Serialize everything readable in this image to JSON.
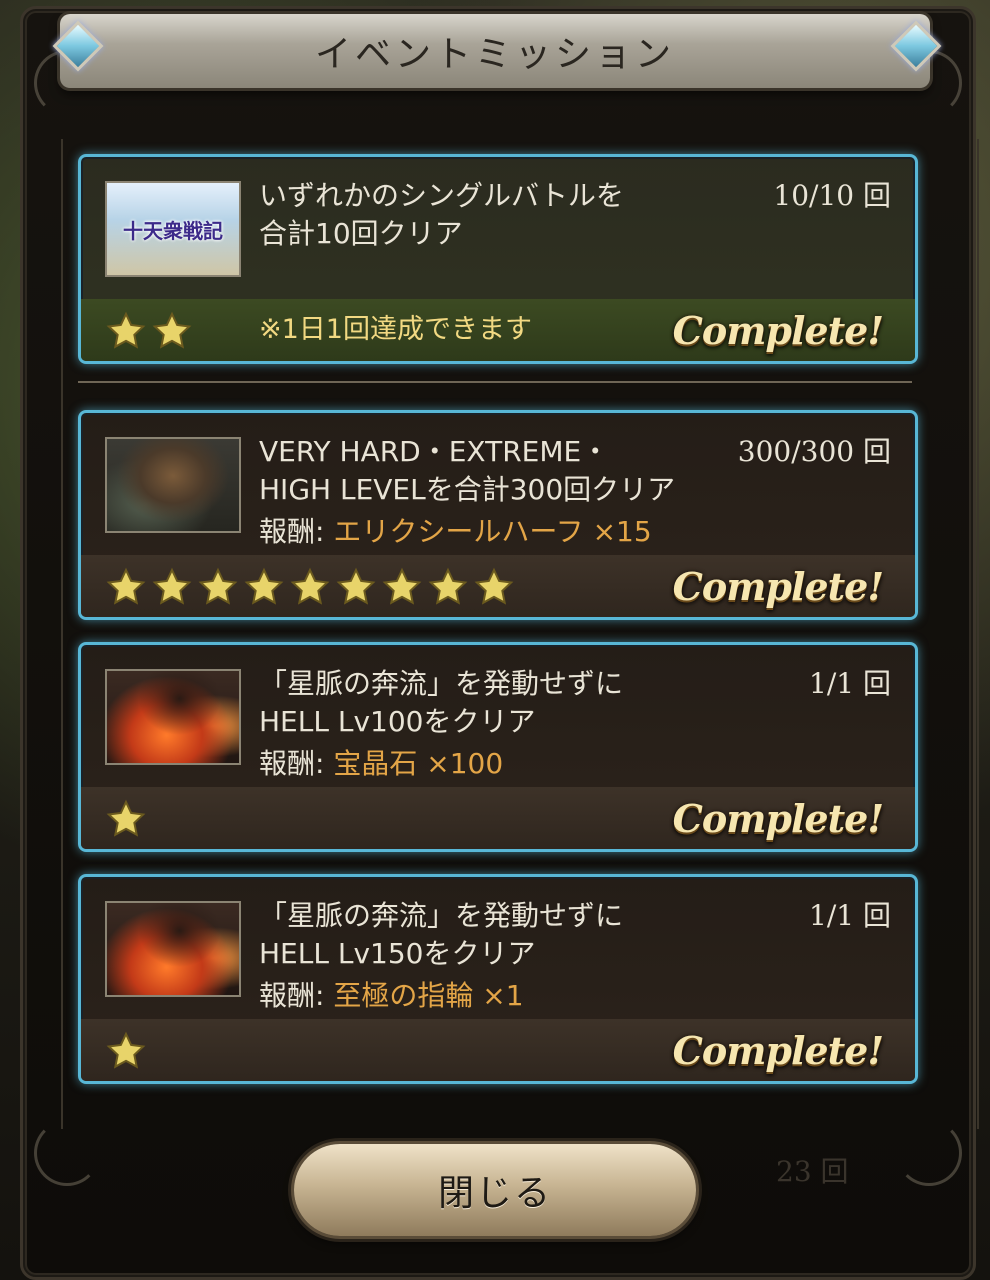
{
  "title": "イベントミッション",
  "missions": [
    {
      "description": "いずれかのシングルバトルを\n合計10回クリア",
      "count": "10/10 回",
      "thumbnail_text": "十天衆戦記",
      "note": "※1日1回達成できます",
      "stars": 2,
      "status": "Complete!"
    },
    {
      "description": "VERY HARD・EXTREME・\nHIGH LEVELを合計300回クリア",
      "count": "300/300 回",
      "reward_label": "報酬: ",
      "reward_item": "エリクシールハーフ ×15",
      "stars": 9,
      "status": "Complete!"
    },
    {
      "description": "「星脈の奔流」を発動せずに\nHELL Lv100をクリア",
      "count": "1/1 回",
      "reward_label": "報酬: ",
      "reward_item": "宝晶石 ×100",
      "stars": 1,
      "status": "Complete!"
    },
    {
      "description": "「星脈の奔流」を発動せずに\nHELL Lv150をクリア",
      "count": "1/1 回",
      "reward_label": "報酬: ",
      "reward_item": "至極の指輪 ×1",
      "stars": 1,
      "status": "Complete!"
    }
  ],
  "close_label": "閉じる",
  "background_counter": "23 回",
  "colors": {
    "card_border": "#58b7d6",
    "reward_item": "#e3a547",
    "daily_note": "#f2d982",
    "star": "#e8d46a"
  },
  "icons": [
    "gem-icon",
    "star-icon"
  ]
}
